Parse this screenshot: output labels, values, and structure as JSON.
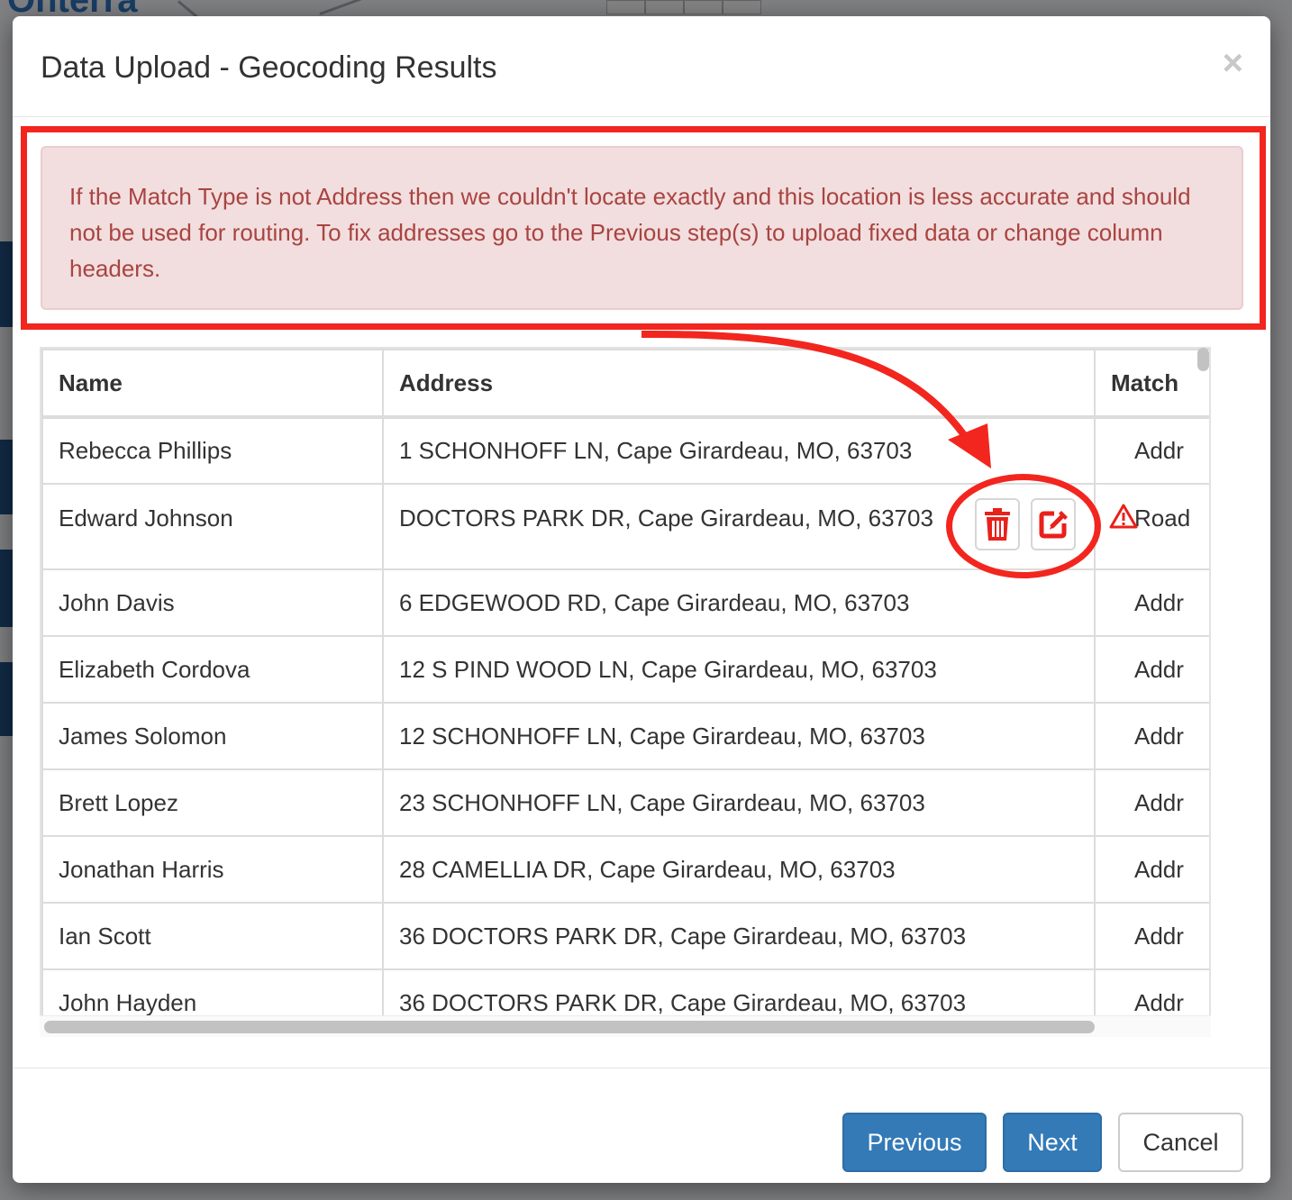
{
  "background": {
    "brand_text": "Onterra"
  },
  "modal": {
    "title": "Data Upload - Geocoding Results",
    "close_label": "×"
  },
  "alert": {
    "text": "If the Match Type is not Address then we couldn't locate exactly and this location is less accurate and should not be used for routing. To fix addresses go to the Previous step(s) to upload fixed data or change column headers."
  },
  "table": {
    "headers": [
      "Name",
      "Address",
      "Match"
    ],
    "rows": [
      {
        "name": "Rebecca Phillips",
        "address": "1 SCHONHOFF LN, Cape Girardeau, MO, 63703",
        "match": "Addr"
      },
      {
        "name": "Edward Johnson",
        "address": "DOCTORS PARK DR, Cape Girardeau, MO, 63703",
        "match": "Road"
      },
      {
        "name": "John Davis",
        "address": "6 EDGEWOOD RD, Cape Girardeau, MO, 63703",
        "match": "Addr"
      },
      {
        "name": "Elizabeth Cordova",
        "address": "12 S PIND WOOD LN, Cape Girardeau, MO, 63703",
        "match": "Addr"
      },
      {
        "name": "James Solomon",
        "address": "12 SCHONHOFF LN, Cape Girardeau, MO, 63703",
        "match": "Addr"
      },
      {
        "name": "Brett Lopez",
        "address": "23 SCHONHOFF LN, Cape Girardeau, MO, 63703",
        "match": "Addr"
      },
      {
        "name": "Jonathan Harris",
        "address": "28 CAMELLIA DR, Cape Girardeau, MO, 63703",
        "match": "Addr"
      },
      {
        "name": "Ian Scott",
        "address": "36 DOCTORS PARK DR, Cape Girardeau, MO, 63703",
        "match": "Addr"
      },
      {
        "name": "John Hayden",
        "address": "36 DOCTORS PARK DR, Cape Girardeau, MO, 63703",
        "match": "Addr"
      }
    ],
    "row_actions": {
      "delete_icon": "trash-icon",
      "edit_icon": "edit-icon"
    },
    "warning_icon": "warning-triangle-icon"
  },
  "footer": {
    "previous_label": "Previous",
    "next_label": "Next",
    "cancel_label": "Cancel"
  },
  "colors": {
    "primary": "#337ab7",
    "alert_text": "#a94442",
    "alert_bg": "#f2dede",
    "annotation_red": "#f2261f"
  }
}
